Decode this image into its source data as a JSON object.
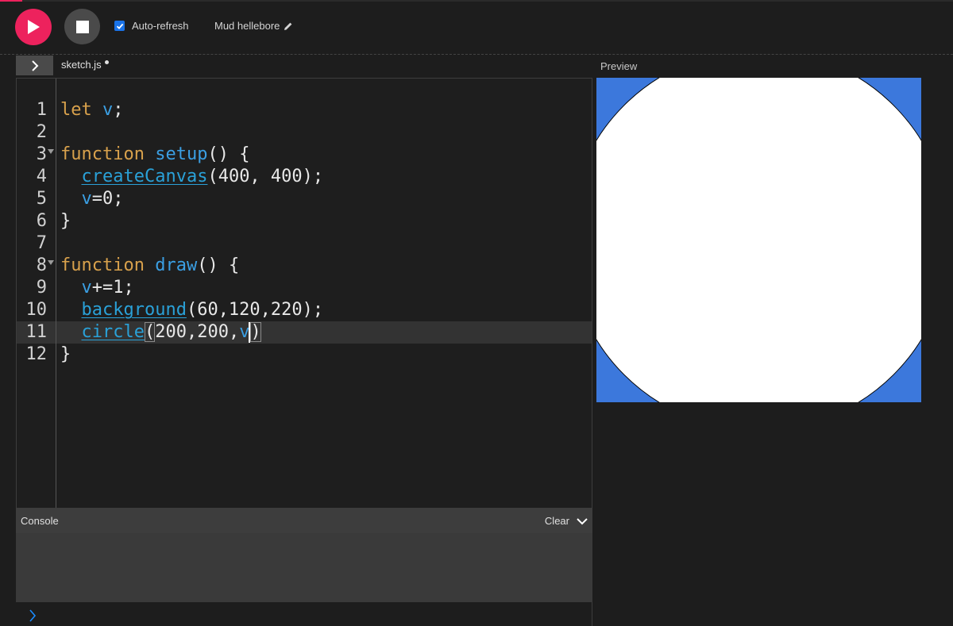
{
  "toolbar": {
    "auto_refresh_label": "Auto-refresh",
    "auto_refresh_checked": true,
    "sketch_name": "Mud hellebore",
    "play_icon": "play-icon",
    "stop_icon": "stop-icon",
    "pencil_icon": "pencil-icon"
  },
  "editor": {
    "file_name": "sketch.js",
    "unsaved": true,
    "current_line": 11,
    "line_numbers": [
      "1",
      "2",
      "3",
      "4",
      "5",
      "6",
      "7",
      "8",
      "9",
      "10",
      "11",
      "12"
    ],
    "lines": [
      "let v;",
      "",
      "function setup() {",
      "  createCanvas(400, 400);",
      "  v=0;",
      "}",
      "",
      "function draw() {",
      "  v+=1;",
      "  background(60,120,220);",
      "  circle(200,200,v)",
      "}"
    ]
  },
  "preview": {
    "label": "Preview",
    "background": "#3c78dc",
    "circle_fill": "#ffffff"
  },
  "console": {
    "label": "Console",
    "clear_label": "Clear",
    "prompt_icon": "chevron-right-icon"
  },
  "colors": {
    "accent": "#ed225d",
    "keyword": "#d8a14c",
    "function": "#3b9fe3"
  }
}
